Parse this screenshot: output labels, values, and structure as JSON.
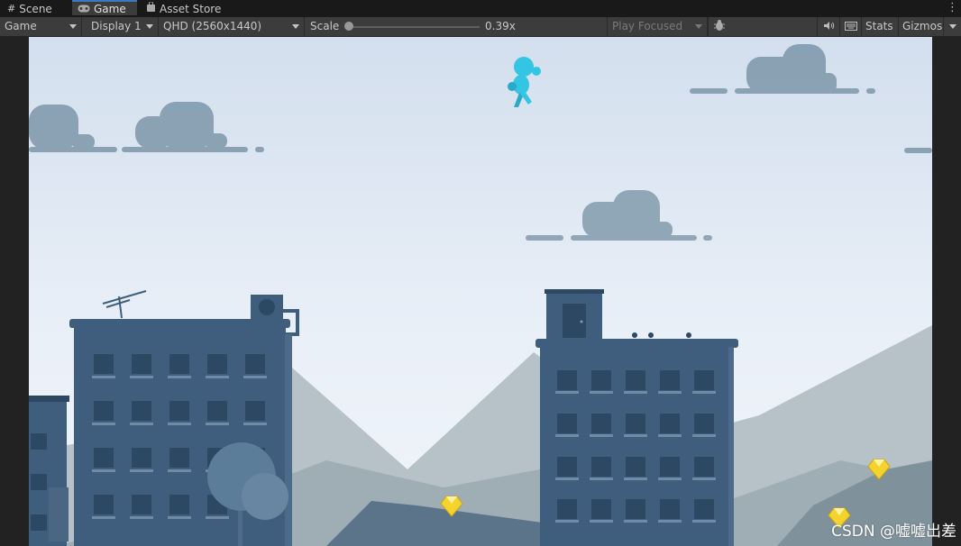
{
  "tabs": [
    {
      "label": "Scene",
      "icon": "grid-icon",
      "active": false
    },
    {
      "label": "Game",
      "icon": "gamepad-icon",
      "active": true
    },
    {
      "label": "Asset Store",
      "icon": "shopping-bag-icon",
      "active": false
    }
  ],
  "toolbar": {
    "view_mode": "Game",
    "display": "Display 1",
    "resolution": "QHD (2560x1440)",
    "scale_label": "Scale",
    "scale_value": "0.39x",
    "scale_fraction": 0.0,
    "play_mode": "Play Focused",
    "stats_label": "Stats",
    "gizmos_label": "Gizmos"
  },
  "watermark": "CSDN @嘘嘘出差",
  "colors": {
    "sky_top": "#d6e2f0",
    "sky_bottom": "#eef3fa",
    "building": "#3f5d7c",
    "building_dark": "#2d4863",
    "mountain": "#8e9ea8",
    "mountain_light": "#a9b6bd",
    "character": "#35c5e4",
    "gem": "#f4d32c",
    "cloud": "#6f8aa0"
  }
}
